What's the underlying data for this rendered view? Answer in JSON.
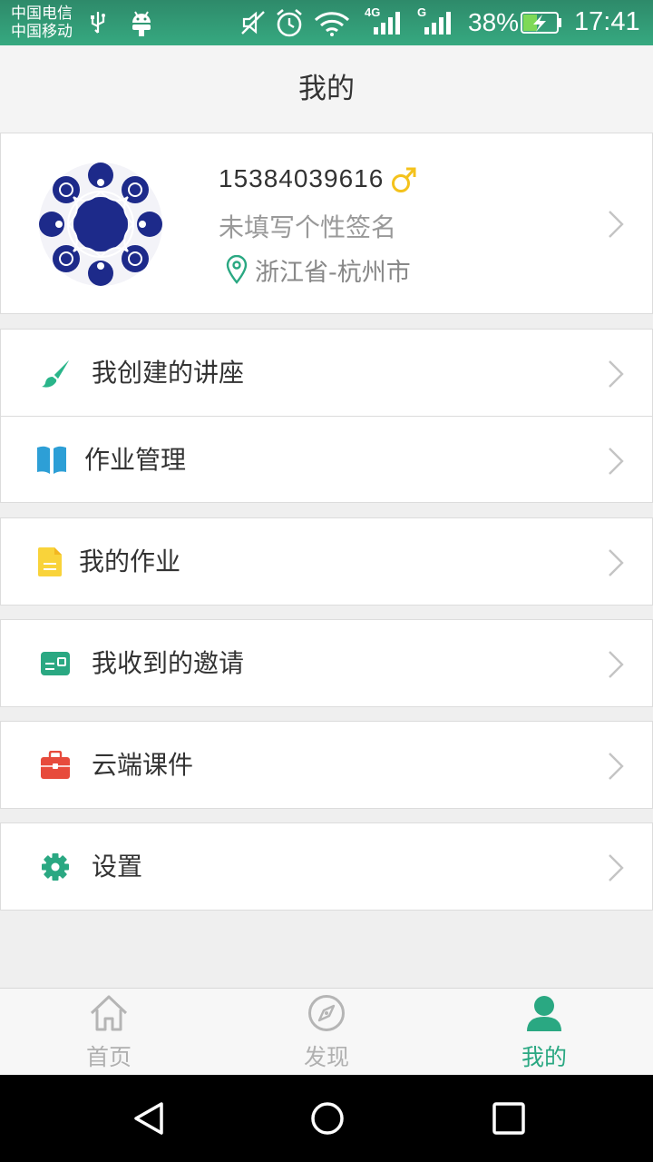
{
  "status_bar": {
    "carrier_1": "中国电信",
    "carrier_2": "中国移动",
    "network_1": "4G",
    "network_2": "G",
    "battery": "38%",
    "time": "17:41",
    "icons": [
      "usb-icon",
      "android-icon",
      "mute-icon",
      "alarm-icon",
      "wifi-icon",
      "signal-icon",
      "battery-charging-icon"
    ]
  },
  "header": {
    "title": "我的"
  },
  "profile": {
    "phone": "15384039616",
    "gender_icon": "male-icon",
    "signature": "未填写个性签名",
    "location": "浙江省-杭州市"
  },
  "menu": {
    "lectures": {
      "label": "我创建的讲座",
      "icon": "brush-icon",
      "color": "#2ab58a"
    },
    "homework_manage": {
      "label": "作业管理",
      "icon": "book-icon",
      "color": "#2d9fd6"
    },
    "my_homework": {
      "label": "我的作业",
      "icon": "document-icon",
      "color": "#f9d33a"
    },
    "invitations": {
      "label": "我收到的邀请",
      "icon": "card-icon",
      "color": "#2aa882"
    },
    "cloud_courseware": {
      "label": "云端课件",
      "icon": "briefcase-icon",
      "color": "#e74b3c"
    },
    "settings": {
      "label": "设置",
      "icon": "gear-icon",
      "color": "#2aa882"
    }
  },
  "tabs": {
    "home": {
      "label": "首页",
      "icon": "home-icon"
    },
    "discover": {
      "label": "发现",
      "icon": "compass-icon"
    },
    "mine": {
      "label": "我的",
      "icon": "person-icon",
      "active": true
    }
  },
  "colors": {
    "accent": "#2aa882",
    "inactive": "#b0b0b0",
    "status_bar": "#2e8a6a",
    "gender": "#f4c21c"
  }
}
